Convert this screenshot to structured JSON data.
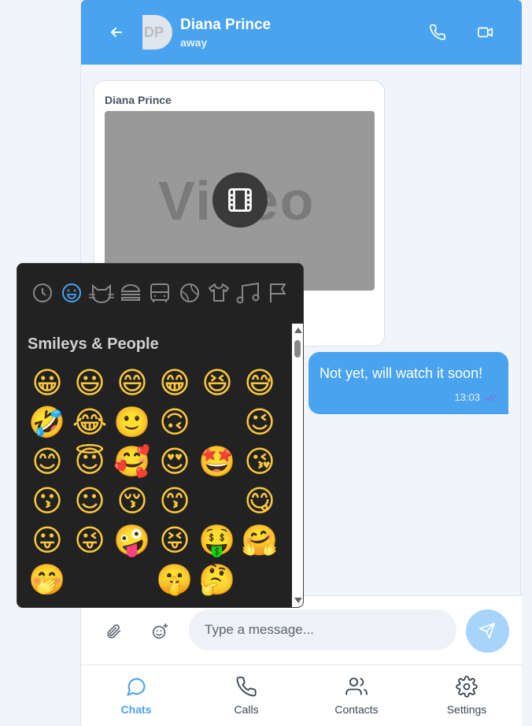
{
  "header": {
    "contact_initials": "DP",
    "contact_name": "Diana Prince",
    "contact_status": "away",
    "icons": [
      "back-arrow-icon",
      "phone-icon",
      "video-camera-icon"
    ]
  },
  "messages": [
    {
      "direction": "incoming",
      "sender": "Diana Prince",
      "type": "video",
      "placeholder_text": "Video"
    },
    {
      "direction": "outgoing",
      "text": "Not yet, will watch it soon!",
      "time": "13:03",
      "status": "read"
    }
  ],
  "emoji_picker": {
    "categories": [
      "recent",
      "smileys-people",
      "animals-nature",
      "food-drink",
      "travel-places",
      "activities",
      "objects",
      "symbols",
      "flags"
    ],
    "active_category": "smileys-people",
    "section_title": "Smileys & People",
    "rows": [
      [
        "😀",
        "😃",
        "😄",
        "😁",
        "😆",
        "😅"
      ],
      [
        "🤣",
        "😂",
        "🙂",
        "🙃",
        "",
        "😉"
      ],
      [
        "😊",
        "😇",
        "🥰",
        "😍",
        "🤩",
        "😘"
      ],
      [
        "😗",
        "☺",
        "😚",
        "😙",
        "",
        "😋"
      ],
      [
        "😛",
        "😜",
        "🤪",
        "😝",
        "🤑",
        "🤗"
      ],
      [
        "🤭",
        "",
        "",
        "🤫",
        "🤔",
        ""
      ]
    ]
  },
  "composer": {
    "placeholder": "Type a message...",
    "icons": [
      "attach-icon",
      "emoji-icon",
      "send-icon"
    ]
  },
  "tabs": [
    {
      "label": "Chats",
      "icon": "chat-bubble-icon",
      "active": true
    },
    {
      "label": "Calls",
      "icon": "phone-icon",
      "active": false
    },
    {
      "label": "Contacts",
      "icon": "contacts-icon",
      "active": false
    },
    {
      "label": "Settings",
      "icon": "gear-icon",
      "active": false
    }
  ],
  "colors": {
    "accent": "#4aa3ef",
    "send_button": "#a7d4fb",
    "picker_bg": "#222222"
  }
}
